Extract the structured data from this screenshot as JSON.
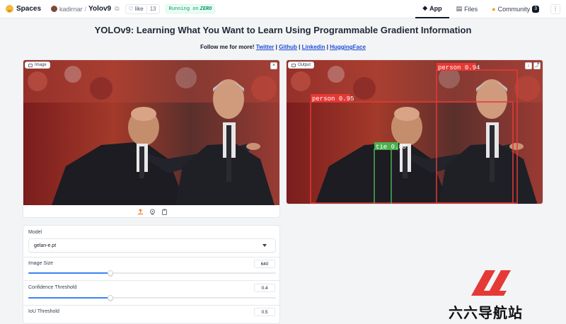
{
  "topbar": {
    "spaces_label": "Spaces",
    "owner": "kadirnar",
    "separator": "/",
    "repo_name": "Yolov9",
    "like_label": "like",
    "like_count": "13",
    "running_prefix": "Running on",
    "running_hardware": "ZERO",
    "nav": [
      {
        "label": "App",
        "icon": "app-icon",
        "active": true
      },
      {
        "label": "Files",
        "icon": "files-icon",
        "active": false
      },
      {
        "label": "Community",
        "icon": "community-icon",
        "active": false,
        "badge": "3"
      }
    ],
    "more_label": "⋮"
  },
  "header": {
    "title": "YOLOv9: Learning What You Want to Learn Using Programmable Gradient Information",
    "follow_text": "Follow me for more!",
    "links": [
      "Twitter",
      "Github",
      "Linkedin",
      "HuggingFace"
    ],
    "separator": "|"
  },
  "input_image": {
    "label": "Image",
    "close_label": "×",
    "toolbar_icons": [
      "upload-icon",
      "webcam-icon",
      "clipboard-icon"
    ]
  },
  "output_image": {
    "label": "Output",
    "download_label": "↓",
    "share_label": "⤴",
    "detections": [
      {
        "label": "person",
        "score": "0.95"
      },
      {
        "label": "person",
        "score": "0.94"
      },
      {
        "label": "tie",
        "score": "0.80"
      }
    ]
  },
  "controls": {
    "model": {
      "label": "Model",
      "value": "gelan-e.pt"
    },
    "image_size": {
      "label": "Image Size",
      "value": "640",
      "fraction": 0.33
    },
    "confidence": {
      "label": "Confidence Threshold",
      "value": "0.4",
      "fraction": 0.33
    },
    "iou": {
      "label": "IoU Threshold",
      "value": "0.5"
    }
  },
  "colors": {
    "accent": "#3b82f6",
    "box_red": "#e53935",
    "box_green": "#4caf50",
    "running_green": "#059669"
  },
  "watermark": {
    "text": "六六导航站"
  }
}
